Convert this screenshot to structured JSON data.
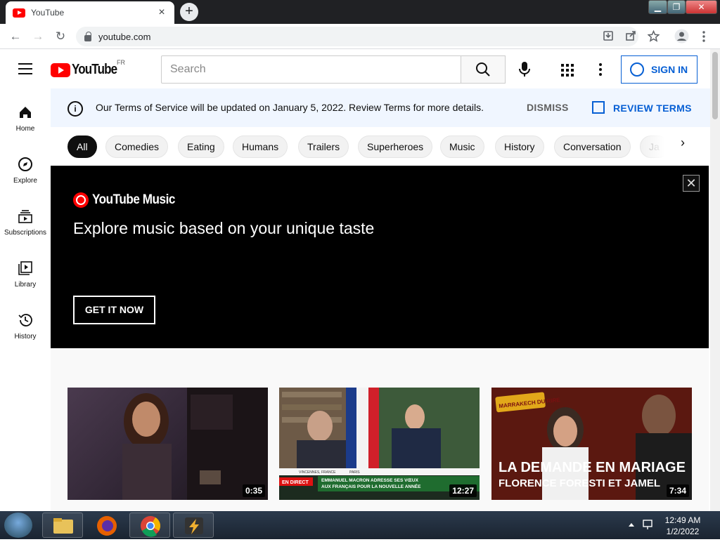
{
  "browser": {
    "tab_title": "YouTube",
    "tab_close": "×",
    "new_tab": "+",
    "url": "youtube.com",
    "window_controls": {
      "minimize": "▁",
      "maximize": "❐",
      "close": "✕"
    },
    "nav": {
      "back": "←",
      "forward": "→",
      "reload": "↻"
    }
  },
  "header": {
    "logo_text": "YouTube",
    "country_code": "FR",
    "search_placeholder": "Search",
    "sign_in_label": "SIGN IN"
  },
  "sidebar": {
    "items": [
      {
        "label": "Home",
        "icon": "home-icon"
      },
      {
        "label": "Explore",
        "icon": "compass-icon"
      },
      {
        "label": "Subscriptions",
        "icon": "subscriptions-icon"
      },
      {
        "label": "Library",
        "icon": "library-icon"
      },
      {
        "label": "History",
        "icon": "history-icon"
      }
    ]
  },
  "banner": {
    "info_icon": "i",
    "message": "Our Terms of Service will be updated on January 5, 2022. Review Terms for more details.",
    "dismiss_label": "DISMISS",
    "review_label": "REVIEW TERMS"
  },
  "chips": {
    "items": [
      "All",
      "Comedies",
      "Eating",
      "Humans",
      "Trailers",
      "Superheroes",
      "Music",
      "History",
      "Conversation",
      "Ja"
    ],
    "next": "›"
  },
  "promo": {
    "logo_text": "YouTube Music",
    "tagline": "Explore music based on your unique taste",
    "button_label": "GET IT NOW",
    "close": "✕"
  },
  "videos": [
    {
      "duration": "0:35"
    },
    {
      "duration": "12:27",
      "overlay_line1": "EMMANUEL MACRON ADRESSE SES VŒUX",
      "overlay_line2": "AUX FRANÇAIS POUR LA NOUVELLE ANNÉE",
      "tag_left": "EN DIRECT",
      "place_left": "VINCENNES, FRANCE",
      "place_right": "PARIS"
    },
    {
      "duration": "7:34",
      "title_line1": "LA DEMANDE EN MARIAGE",
      "title_line2": "FLORENCE FORESTI ET JAMEL",
      "badge": "MARRAKECH DU RIRE"
    }
  ],
  "taskbar": {
    "time": "12:49 AM",
    "date": "1/2/2022"
  },
  "colors": {
    "accent": "#065fd4",
    "brand": "#ff0000",
    "banner_bg": "#f0f6ff"
  }
}
